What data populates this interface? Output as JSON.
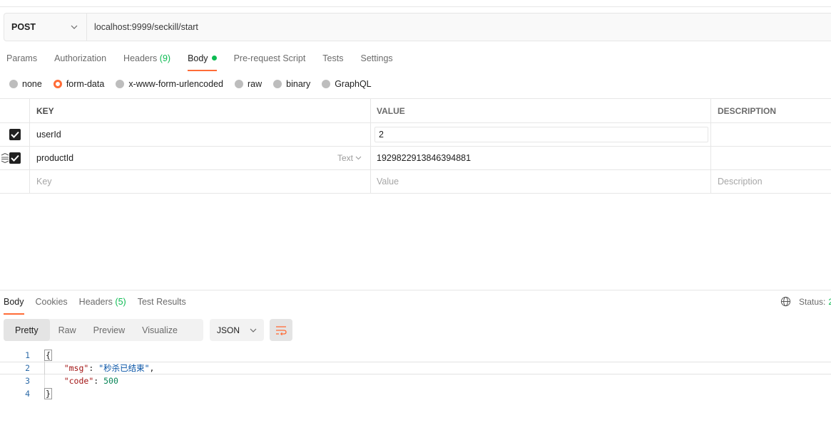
{
  "request": {
    "method": "POST",
    "url": "localhost:9999/seckill/start"
  },
  "req_tabs": [
    {
      "label": "Params"
    },
    {
      "label": "Authorization"
    },
    {
      "label": "Headers",
      "count": "(9)"
    },
    {
      "label": "Body"
    },
    {
      "label": "Pre-request Script"
    },
    {
      "label": "Tests"
    },
    {
      "label": "Settings"
    }
  ],
  "body_types": [
    "none",
    "form-data",
    "x-www-form-urlencoded",
    "raw",
    "binary",
    "GraphQL"
  ],
  "table": {
    "headers": [
      "KEY",
      "VALUE",
      "DESCRIPTION"
    ],
    "rows": [
      {
        "key": "userId",
        "value": "2",
        "type": ""
      },
      {
        "key": "productId",
        "value": "1929822913846394881",
        "type": "Text"
      }
    ],
    "placeholders": {
      "key": "Key",
      "value": "Value",
      "description": "Description"
    }
  },
  "response": {
    "tabs": [
      {
        "label": "Body"
      },
      {
        "label": "Cookies"
      },
      {
        "label": "Headers",
        "count": "(5)"
      },
      {
        "label": "Test Results"
      }
    ],
    "status_label": "Status:",
    "status_code": "2",
    "views": [
      "Pretty",
      "Raw",
      "Preview",
      "Visualize"
    ],
    "format": "JSON",
    "line_numbers": [
      "1",
      "2",
      "3",
      "4"
    ],
    "json": {
      "open": "{",
      "msg_key": "\"msg\"",
      "msg_val": "\"秒杀已结束\"",
      "code_key": "\"code\"",
      "code_val": "500",
      "close": "}"
    }
  },
  "colors": {
    "accent": "#ff6c37",
    "count_green": "#0cbb52"
  }
}
